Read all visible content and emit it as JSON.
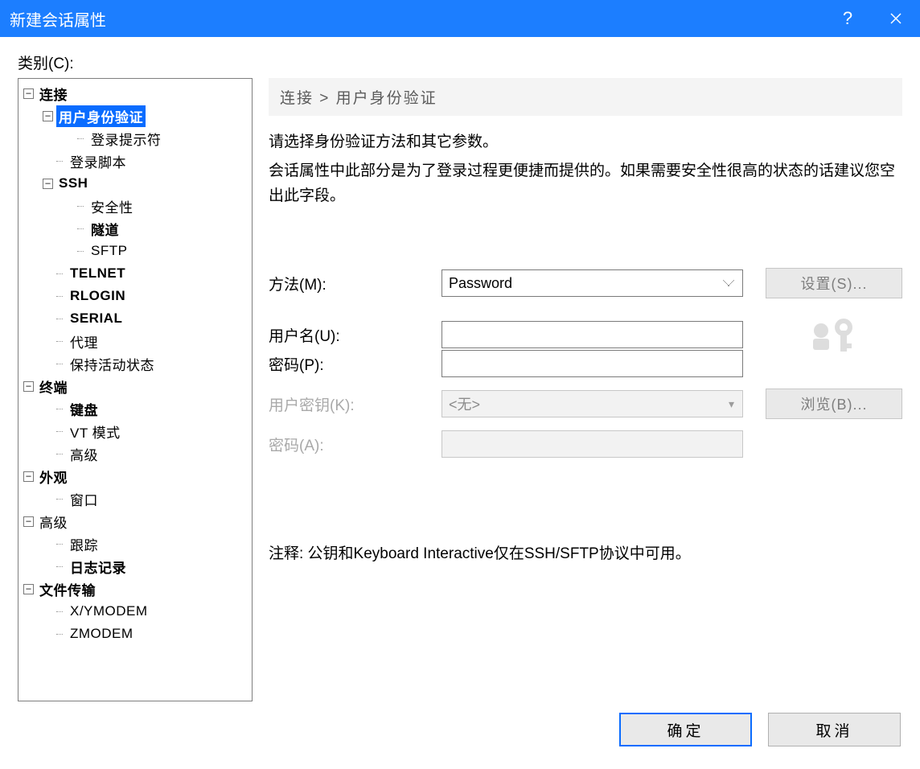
{
  "titlebar": {
    "title": "新建会话属性"
  },
  "category_label": "类别(C):",
  "tree": {
    "connection": "连接",
    "user_auth": "用户身份验证",
    "login_prompt": "登录提示符",
    "login_script": "登录脚本",
    "ssh": "SSH",
    "security": "安全性",
    "tunnel": "隧道",
    "sftp": "SFTP",
    "telnet": "TELNET",
    "rlogin": "RLOGIN",
    "serial": "SERIAL",
    "proxy": "代理",
    "keepalive": "保持活动状态",
    "terminal": "终端",
    "keyboard": "键盘",
    "vtmode": "VT 模式",
    "advanced_term": "高级",
    "appearance": "外观",
    "window": "窗口",
    "advanced": "高级",
    "trace": "跟踪",
    "logging": "日志记录",
    "file_transfer": "文件传输",
    "xymodem": "X/YMODEM",
    "zmodem": "ZMODEM"
  },
  "breadcrumb": "连接 > 用户身份验证",
  "desc": {
    "line1": "请选择身份验证方法和其它参数。",
    "line2": "会话属性中此部分是为了登录过程更便捷而提供的。如果需要安全性很高的状态的话建议您空出此字段。"
  },
  "form": {
    "method_label": "方法(M):",
    "method_value": "Password",
    "setup_btn": "设置(S)...",
    "username_label": "用户名(U):",
    "username_value": "",
    "password_label": "密码(P):",
    "password_value": "",
    "userkey_label": "用户密钥(K):",
    "userkey_value": "<无>",
    "browse_btn": "浏览(B)...",
    "passphrase_label": "密码(A):"
  },
  "note": "注释: 公钥和Keyboard Interactive仅在SSH/SFTP协议中可用。",
  "buttons": {
    "ok": "确定",
    "cancel": "取消"
  }
}
